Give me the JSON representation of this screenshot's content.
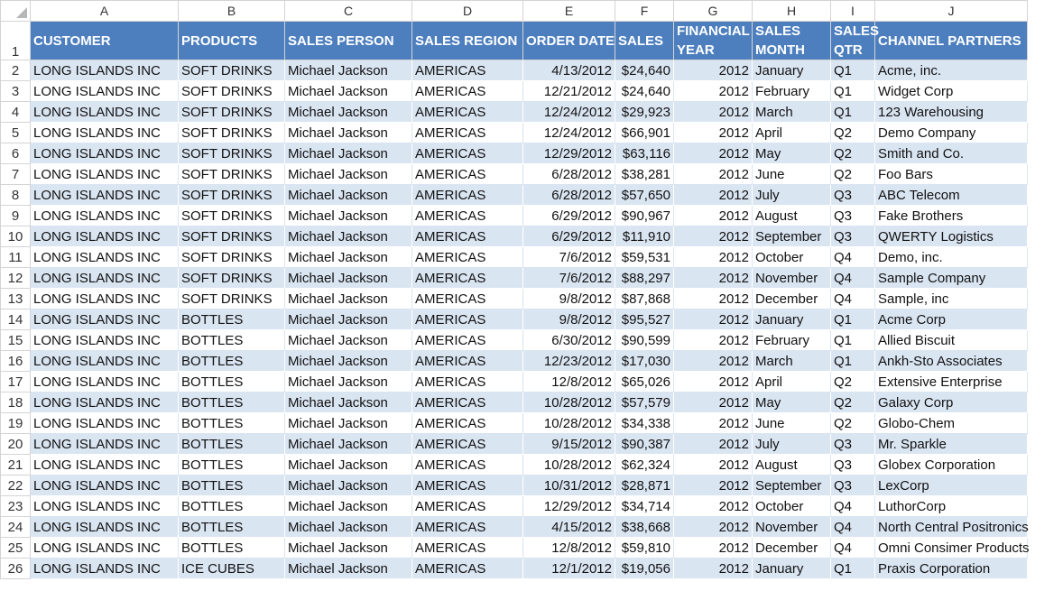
{
  "columns": [
    "A",
    "B",
    "C",
    "D",
    "E",
    "F",
    "G",
    "H",
    "I",
    "J"
  ],
  "headers": {
    "customer": "CUSTOMER",
    "products": "PRODUCTS",
    "sales_person": "SALES PERSON",
    "sales_region": "SALES REGION",
    "order_date": "ORDER DATE",
    "sales": "SALES",
    "financial_year_1": "FINANCIAL",
    "financial_year_2": "YEAR",
    "sales_month_1": "SALES",
    "sales_month_2": "MONTH",
    "sales_qtr_1": "SALES",
    "sales_qtr_2": "QTR",
    "channel_partners": "CHANNEL PARTNERS"
  },
  "header_row_number": "1",
  "rows": [
    {
      "n": "2",
      "customer": "LONG ISLANDS INC",
      "product": "SOFT DRINKS",
      "person": "Michael Jackson",
      "region": "AMERICAS",
      "date": "4/13/2012",
      "sales": "$24,640",
      "year": "2012",
      "month": "January",
      "qtr": "Q1",
      "partner": "Acme, inc."
    },
    {
      "n": "3",
      "customer": "LONG ISLANDS INC",
      "product": "SOFT DRINKS",
      "person": "Michael Jackson",
      "region": "AMERICAS",
      "date": "12/21/2012",
      "sales": "$24,640",
      "year": "2012",
      "month": "February",
      "qtr": "Q1",
      "partner": "Widget Corp"
    },
    {
      "n": "4",
      "customer": "LONG ISLANDS INC",
      "product": "SOFT DRINKS",
      "person": "Michael Jackson",
      "region": "AMERICAS",
      "date": "12/24/2012",
      "sales": "$29,923",
      "year": "2012",
      "month": "March",
      "qtr": "Q1",
      "partner": "123 Warehousing"
    },
    {
      "n": "5",
      "customer": "LONG ISLANDS INC",
      "product": "SOFT DRINKS",
      "person": "Michael Jackson",
      "region": "AMERICAS",
      "date": "12/24/2012",
      "sales": "$66,901",
      "year": "2012",
      "month": "April",
      "qtr": "Q2",
      "partner": "Demo Company"
    },
    {
      "n": "6",
      "customer": "LONG ISLANDS INC",
      "product": "SOFT DRINKS",
      "person": "Michael Jackson",
      "region": "AMERICAS",
      "date": "12/29/2012",
      "sales": "$63,116",
      "year": "2012",
      "month": "May",
      "qtr": "Q2",
      "partner": "Smith and Co."
    },
    {
      "n": "7",
      "customer": "LONG ISLANDS INC",
      "product": "SOFT DRINKS",
      "person": "Michael Jackson",
      "region": "AMERICAS",
      "date": "6/28/2012",
      "sales": "$38,281",
      "year": "2012",
      "month": "June",
      "qtr": "Q2",
      "partner": "Foo Bars"
    },
    {
      "n": "8",
      "customer": "LONG ISLANDS INC",
      "product": "SOFT DRINKS",
      "person": "Michael Jackson",
      "region": "AMERICAS",
      "date": "6/28/2012",
      "sales": "$57,650",
      "year": "2012",
      "month": "July",
      "qtr": "Q3",
      "partner": "ABC Telecom"
    },
    {
      "n": "9",
      "customer": "LONG ISLANDS INC",
      "product": "SOFT DRINKS",
      "person": "Michael Jackson",
      "region": "AMERICAS",
      "date": "6/29/2012",
      "sales": "$90,967",
      "year": "2012",
      "month": "August",
      "qtr": "Q3",
      "partner": "Fake Brothers"
    },
    {
      "n": "10",
      "customer": "LONG ISLANDS INC",
      "product": "SOFT DRINKS",
      "person": "Michael Jackson",
      "region": "AMERICAS",
      "date": "6/29/2012",
      "sales": "$11,910",
      "year": "2012",
      "month": "September",
      "qtr": "Q3",
      "partner": "QWERTY Logistics"
    },
    {
      "n": "11",
      "customer": "LONG ISLANDS INC",
      "product": "SOFT DRINKS",
      "person": "Michael Jackson",
      "region": "AMERICAS",
      "date": "7/6/2012",
      "sales": "$59,531",
      "year": "2012",
      "month": "October",
      "qtr": "Q4",
      "partner": "Demo, inc."
    },
    {
      "n": "12",
      "customer": "LONG ISLANDS INC",
      "product": "SOFT DRINKS",
      "person": "Michael Jackson",
      "region": "AMERICAS",
      "date": "7/6/2012",
      "sales": "$88,297",
      "year": "2012",
      "month": "November",
      "qtr": "Q4",
      "partner": "Sample Company"
    },
    {
      "n": "13",
      "customer": "LONG ISLANDS INC",
      "product": "SOFT DRINKS",
      "person": "Michael Jackson",
      "region": "AMERICAS",
      "date": "9/8/2012",
      "sales": "$87,868",
      "year": "2012",
      "month": "December",
      "qtr": "Q4",
      "partner": "Sample, inc"
    },
    {
      "n": "14",
      "customer": "LONG ISLANDS INC",
      "product": "BOTTLES",
      "person": "Michael Jackson",
      "region": "AMERICAS",
      "date": "9/8/2012",
      "sales": "$95,527",
      "year": "2012",
      "month": "January",
      "qtr": "Q1",
      "partner": "Acme Corp"
    },
    {
      "n": "15",
      "customer": "LONG ISLANDS INC",
      "product": "BOTTLES",
      "person": "Michael Jackson",
      "region": "AMERICAS",
      "date": "6/30/2012",
      "sales": "$90,599",
      "year": "2012",
      "month": "February",
      "qtr": "Q1",
      "partner": "Allied Biscuit"
    },
    {
      "n": "16",
      "customer": "LONG ISLANDS INC",
      "product": "BOTTLES",
      "person": "Michael Jackson",
      "region": "AMERICAS",
      "date": "12/23/2012",
      "sales": "$17,030",
      "year": "2012",
      "month": "March",
      "qtr": "Q1",
      "partner": "Ankh-Sto Associates"
    },
    {
      "n": "17",
      "customer": "LONG ISLANDS INC",
      "product": "BOTTLES",
      "person": "Michael Jackson",
      "region": "AMERICAS",
      "date": "12/8/2012",
      "sales": "$65,026",
      "year": "2012",
      "month": "April",
      "qtr": "Q2",
      "partner": "Extensive Enterprise"
    },
    {
      "n": "18",
      "customer": "LONG ISLANDS INC",
      "product": "BOTTLES",
      "person": "Michael Jackson",
      "region": "AMERICAS",
      "date": "10/28/2012",
      "sales": "$57,579",
      "year": "2012",
      "month": "May",
      "qtr": "Q2",
      "partner": "Galaxy Corp"
    },
    {
      "n": "19",
      "customer": "LONG ISLANDS INC",
      "product": "BOTTLES",
      "person": "Michael Jackson",
      "region": "AMERICAS",
      "date": "10/28/2012",
      "sales": "$34,338",
      "year": "2012",
      "month": "June",
      "qtr": "Q2",
      "partner": "Globo-Chem"
    },
    {
      "n": "20",
      "customer": "LONG ISLANDS INC",
      "product": "BOTTLES",
      "person": "Michael Jackson",
      "region": "AMERICAS",
      "date": "9/15/2012",
      "sales": "$90,387",
      "year": "2012",
      "month": "July",
      "qtr": "Q3",
      "partner": "Mr. Sparkle"
    },
    {
      "n": "21",
      "customer": "LONG ISLANDS INC",
      "product": "BOTTLES",
      "person": "Michael Jackson",
      "region": "AMERICAS",
      "date": "10/28/2012",
      "sales": "$62,324",
      "year": "2012",
      "month": "August",
      "qtr": "Q3",
      "partner": "Globex Corporation"
    },
    {
      "n": "22",
      "customer": "LONG ISLANDS INC",
      "product": "BOTTLES",
      "person": "Michael Jackson",
      "region": "AMERICAS",
      "date": "10/31/2012",
      "sales": "$28,871",
      "year": "2012",
      "month": "September",
      "qtr": "Q3",
      "partner": "LexCorp"
    },
    {
      "n": "23",
      "customer": "LONG ISLANDS INC",
      "product": "BOTTLES",
      "person": "Michael Jackson",
      "region": "AMERICAS",
      "date": "12/29/2012",
      "sales": "$34,714",
      "year": "2012",
      "month": "October",
      "qtr": "Q4",
      "partner": "LuthorCorp"
    },
    {
      "n": "24",
      "customer": "LONG ISLANDS INC",
      "product": "BOTTLES",
      "person": "Michael Jackson",
      "region": "AMERICAS",
      "date": "4/15/2012",
      "sales": "$38,668",
      "year": "2012",
      "month": "November",
      "qtr": "Q4",
      "partner": "North Central Positronics"
    },
    {
      "n": "25",
      "customer": "LONG ISLANDS INC",
      "product": "BOTTLES",
      "person": "Michael Jackson",
      "region": "AMERICAS",
      "date": "12/8/2012",
      "sales": "$59,810",
      "year": "2012",
      "month": "December",
      "qtr": "Q4",
      "partner": "Omni Consimer Products"
    },
    {
      "n": "26",
      "customer": "LONG ISLANDS INC",
      "product": "ICE CUBES",
      "person": "Michael Jackson",
      "region": "AMERICAS",
      "date": "12/1/2012",
      "sales": "$19,056",
      "year": "2012",
      "month": "January",
      "qtr": "Q1",
      "partner": "Praxis Corporation"
    }
  ],
  "colors": {
    "header_fill": "#4d7fbf",
    "band_fill": "#dae5f2",
    "header_text": "#ffffff"
  }
}
